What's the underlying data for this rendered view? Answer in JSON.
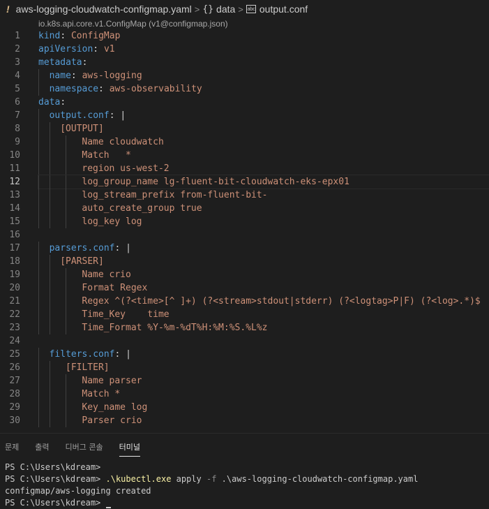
{
  "breadcrumb": {
    "file": "aws-logging-cloudwatch-configmap.yaml",
    "braces": "{}",
    "segment1": "data",
    "segment2": "output.conf",
    "sep": ">"
  },
  "schema": "io.k8s.api.core.v1.ConfigMap (v1@configmap.json)",
  "editor": {
    "current_line": 12,
    "lines": [
      {
        "n": "1",
        "indent": 0,
        "parts": [
          [
            "k",
            "kind"
          ],
          [
            "p",
            ": "
          ],
          [
            "s",
            "ConfigMap"
          ]
        ]
      },
      {
        "n": "2",
        "indent": 0,
        "parts": [
          [
            "k",
            "apiVersion"
          ],
          [
            "p",
            ": "
          ],
          [
            "s",
            "v1"
          ]
        ]
      },
      {
        "n": "3",
        "indent": 0,
        "parts": [
          [
            "k",
            "metadata"
          ],
          [
            "p",
            ":"
          ]
        ]
      },
      {
        "n": "4",
        "indent": 2,
        "parts": [
          [
            "k",
            "name"
          ],
          [
            "p",
            ": "
          ],
          [
            "s",
            "aws-logging"
          ]
        ]
      },
      {
        "n": "5",
        "indent": 2,
        "parts": [
          [
            "k",
            "namespace"
          ],
          [
            "p",
            ": "
          ],
          [
            "s",
            "aws-observability"
          ]
        ]
      },
      {
        "n": "6",
        "indent": 0,
        "parts": [
          [
            "k",
            "data"
          ],
          [
            "p",
            ":"
          ]
        ]
      },
      {
        "n": "7",
        "indent": 2,
        "parts": [
          [
            "k",
            "output.conf"
          ],
          [
            "p",
            ": "
          ],
          [
            "p",
            "|"
          ]
        ]
      },
      {
        "n": "8",
        "indent": 4,
        "parts": [
          [
            "s",
            "[OUTPUT]"
          ]
        ]
      },
      {
        "n": "9",
        "indent": 8,
        "parts": [
          [
            "s",
            "Name cloudwatch"
          ]
        ]
      },
      {
        "n": "10",
        "indent": 8,
        "parts": [
          [
            "s",
            "Match   *"
          ]
        ]
      },
      {
        "n": "11",
        "indent": 8,
        "parts": [
          [
            "s",
            "region us-west-2"
          ]
        ]
      },
      {
        "n": "12",
        "indent": 8,
        "parts": [
          [
            "s",
            "log_group_name lg-fluent-bit-cloudwatch-eks-epx01"
          ]
        ]
      },
      {
        "n": "13",
        "indent": 8,
        "parts": [
          [
            "s",
            "log_stream_prefix from-fluent-bit-"
          ]
        ]
      },
      {
        "n": "14",
        "indent": 8,
        "parts": [
          [
            "s",
            "auto_create_group true"
          ]
        ]
      },
      {
        "n": "15",
        "indent": 8,
        "parts": [
          [
            "s",
            "log_key log"
          ]
        ]
      },
      {
        "n": "16",
        "indent": 0,
        "parts": []
      },
      {
        "n": "17",
        "indent": 2,
        "parts": [
          [
            "k",
            "parsers.conf"
          ],
          [
            "p",
            ": "
          ],
          [
            "p",
            "|"
          ]
        ]
      },
      {
        "n": "18",
        "indent": 4,
        "parts": [
          [
            "s",
            "[PARSER]"
          ]
        ]
      },
      {
        "n": "19",
        "indent": 8,
        "parts": [
          [
            "s",
            "Name crio"
          ]
        ]
      },
      {
        "n": "20",
        "indent": 8,
        "parts": [
          [
            "s",
            "Format Regex"
          ]
        ]
      },
      {
        "n": "21",
        "indent": 8,
        "parts": [
          [
            "s",
            "Regex ^(?<time>[^ ]+) (?<stream>stdout|stderr) (?<logtag>P|F) (?<log>.*)$"
          ]
        ]
      },
      {
        "n": "22",
        "indent": 8,
        "parts": [
          [
            "s",
            "Time_Key    time"
          ]
        ]
      },
      {
        "n": "23",
        "indent": 8,
        "parts": [
          [
            "s",
            "Time_Format %Y-%m-%dT%H:%M:%S.%L%z"
          ]
        ]
      },
      {
        "n": "24",
        "indent": 0,
        "parts": []
      },
      {
        "n": "25",
        "indent": 2,
        "parts": [
          [
            "k",
            "filters.conf"
          ],
          [
            "p",
            ": "
          ],
          [
            "p",
            "|"
          ]
        ]
      },
      {
        "n": "26",
        "indent": 5,
        "parts": [
          [
            "s",
            "[FILTER]"
          ]
        ]
      },
      {
        "n": "27",
        "indent": 8,
        "parts": [
          [
            "s",
            "Name parser"
          ]
        ]
      },
      {
        "n": "28",
        "indent": 8,
        "parts": [
          [
            "s",
            "Match *"
          ]
        ]
      },
      {
        "n": "29",
        "indent": 8,
        "parts": [
          [
            "s",
            "Key_name log"
          ]
        ]
      },
      {
        "n": "30",
        "indent": 8,
        "parts": [
          [
            "s",
            "Parser crio"
          ]
        ]
      }
    ]
  },
  "panel": {
    "tabs": [
      "문제",
      "출력",
      "디버그 콘솔",
      "터미널"
    ],
    "active_tab": "터미널",
    "terminal": {
      "line1": "PS C:\\Users\\kdream>",
      "line2_prompt": "PS C:\\Users\\kdream> ",
      "line2_cmd": ".\\kubectl.exe",
      "line2_arg1": " apply ",
      "line2_flag": "-f",
      "line2_arg2": " .\\aws-logging-cloudwatch-configmap.yaml",
      "line3": "configmap/aws-logging created",
      "line4": "PS C:\\Users\\kdream> "
    }
  },
  "colors": {
    "keyword": "#569cd6",
    "string": "#ce9178",
    "punct": "#d4d4d4",
    "warning_icon": "#e2c08d",
    "terminal_cmd": "#f9f1a5"
  },
  "icons": {
    "file_type": "yaml-exclamation-icon",
    "object": "braces-icon",
    "string": "abc-string-icon"
  }
}
